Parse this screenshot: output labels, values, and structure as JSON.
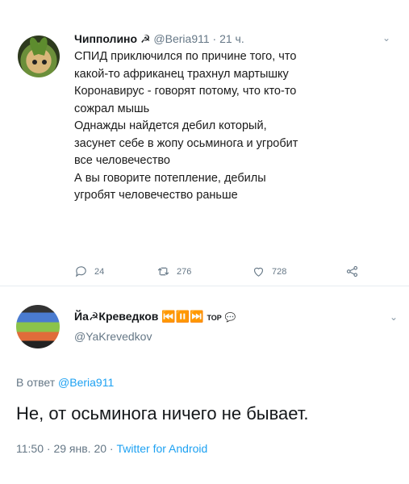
{
  "tweet1": {
    "name": "Чипполино",
    "name_emoji": "☭",
    "handle": "@Beria911",
    "time": "21 ч.",
    "lines": [
      "СПИД приключился  по причине того, что",
      "какой-то африканец трахнул мартышку",
      "Коронавирус - говорят потому, что кто-то",
      "сожрал мышь",
      "Однажды найдется дебил который,",
      "засунет себе в жопу осьминога и угробит",
      "все человечество",
      "А вы говорите потепление, дебилы",
      "угробят человечество раньше"
    ],
    "replies": "24",
    "retweets": "276",
    "likes": "728"
  },
  "tweet2": {
    "name": "Йа☭Креведков",
    "name_extra": "⏮️⏸️⏭️",
    "badge": "TOP",
    "handle": "@YaKrevedkov",
    "reply_prefix": "В ответ",
    "reply_mention": "@Beria911",
    "text": "Не, от осьминога ничего не бывает.",
    "time": "11:50",
    "date": "29 янв. 20",
    "client": "Twitter for Android"
  }
}
